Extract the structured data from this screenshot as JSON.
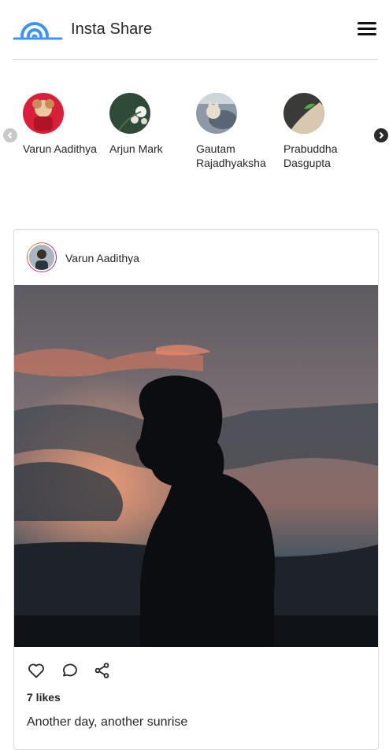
{
  "app": {
    "title": "Insta Share"
  },
  "stories": [
    {
      "name": "Varun Aadithya",
      "avatar": "dog-photo"
    },
    {
      "name": "Arjun Mark",
      "avatar": "flower-photo"
    },
    {
      "name": "Gautam Rajadhyaksha",
      "avatar": "cat-photo"
    },
    {
      "name": "Prabuddha Dasgupta",
      "avatar": "hand-leaf-photo"
    }
  ],
  "post": {
    "username": "Varun Aadithya",
    "image": "silhouette-sunset-photo",
    "likes_text": "7 likes",
    "caption": "Another day, another sunrise"
  },
  "colors": {
    "accent": "#4094ef",
    "text": "#262626",
    "border": "#dbdbdb"
  }
}
